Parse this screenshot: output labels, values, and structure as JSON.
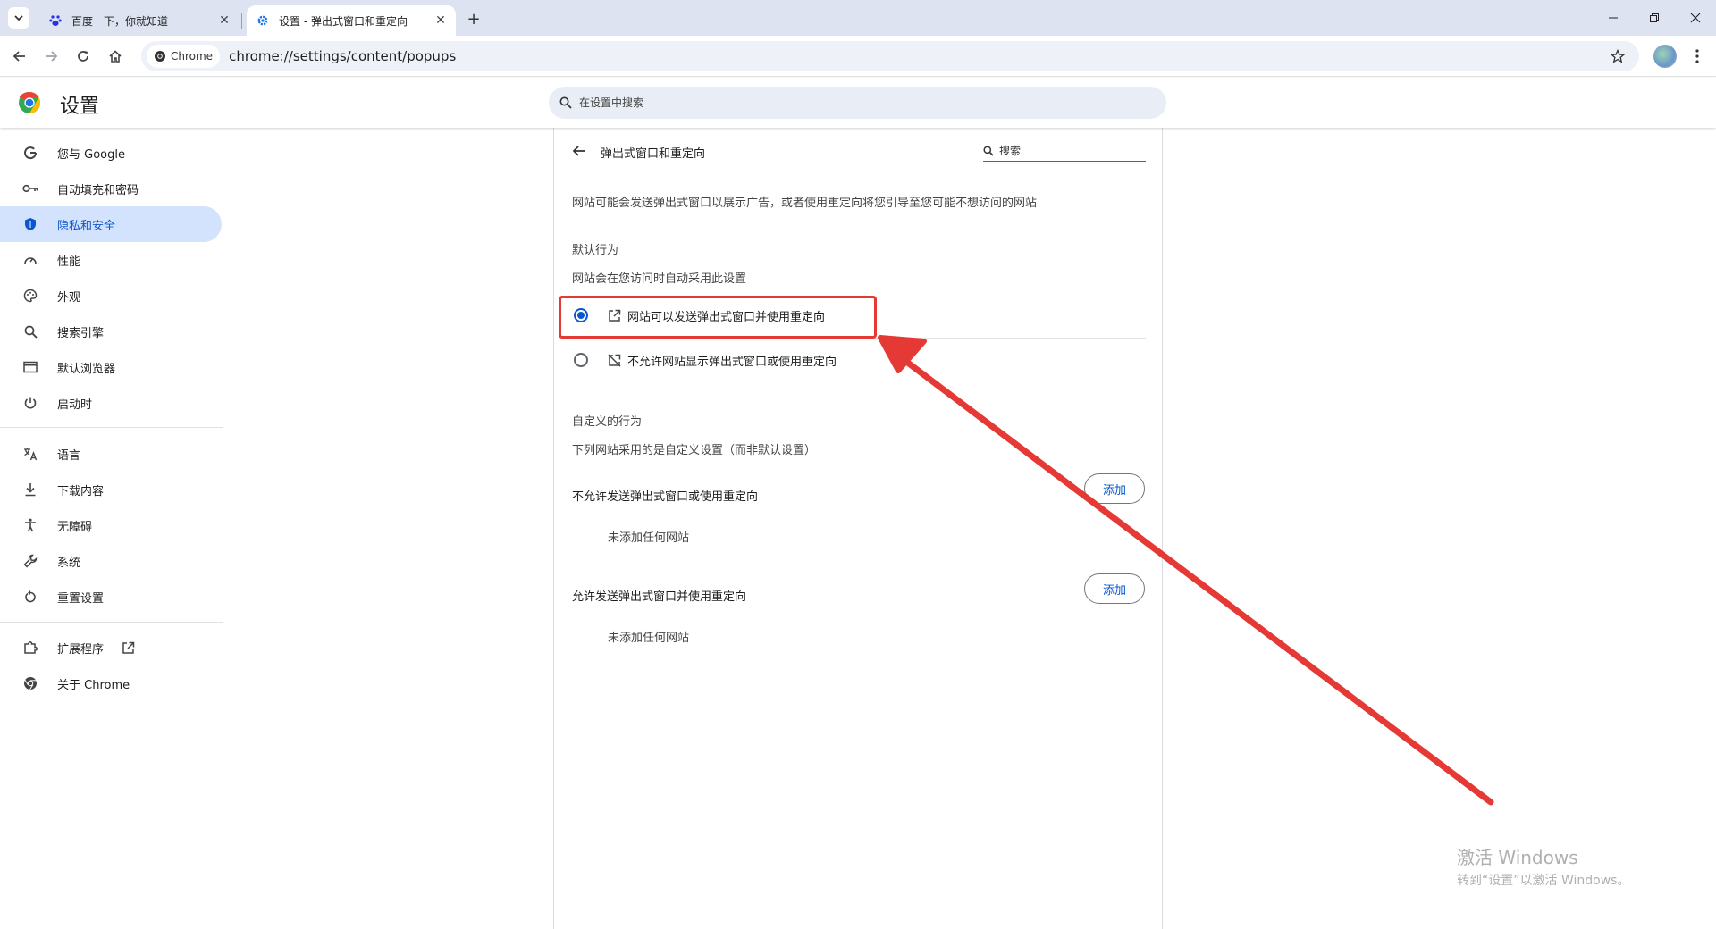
{
  "browser": {
    "tabs": [
      {
        "title": "百度一下，你就知道",
        "active": false,
        "favicon": "baidu-paw-icon"
      },
      {
        "title": "设置 - 弹出式窗口和重定向",
        "active": true,
        "favicon": "settings-gear-icon"
      }
    ],
    "chip_label": "Chrome",
    "url": "chrome://settings/content/popups"
  },
  "header": {
    "title": "设置",
    "search_placeholder": "在设置中搜索"
  },
  "sidebar": {
    "items": [
      {
        "label": "您与 Google",
        "icon": "google-g-icon"
      },
      {
        "label": "自动填充和密码",
        "icon": "key-icon"
      },
      {
        "label": "隐私和安全",
        "icon": "shield-icon",
        "selected": true
      },
      {
        "label": "性能",
        "icon": "speedometer-icon"
      },
      {
        "label": "外观",
        "icon": "palette-icon"
      },
      {
        "label": "搜索引擎",
        "icon": "search-icon"
      },
      {
        "label": "默认浏览器",
        "icon": "browser-window-icon"
      },
      {
        "label": "启动时",
        "icon": "power-icon"
      },
      {
        "label": "语言",
        "icon": "translate-icon"
      },
      {
        "label": "下载内容",
        "icon": "download-icon"
      },
      {
        "label": "无障碍",
        "icon": "accessibility-icon"
      },
      {
        "label": "系统",
        "icon": "wrench-icon"
      },
      {
        "label": "重置设置",
        "icon": "reset-icon"
      },
      {
        "label": "扩展程序",
        "icon": "puzzle-icon"
      },
      {
        "label": "关于 Chrome",
        "icon": "chrome-logo-icon"
      }
    ]
  },
  "page": {
    "title": "弹出式窗口和重定向",
    "search_placeholder": "搜索",
    "description": "网站可能会发送弹出式窗口以展示广告，或者使用重定向将您引导至您可能不想访问的网站",
    "default_section": {
      "title": "默认行为",
      "subtitle": "网站会在您访问时自动采用此设置",
      "options": [
        {
          "label": "网站可以发送弹出式窗口并使用重定向",
          "selected": true,
          "icon": "open-in-new-icon"
        },
        {
          "label": "不允许网站显示弹出式窗口或使用重定向",
          "selected": false,
          "icon": "popup-blocked-icon"
        }
      ]
    },
    "custom_section": {
      "title": "自定义的行为",
      "subtitle": "下列网站采用的是自定义设置（而非默认设置）",
      "lists": [
        {
          "label": "不允许发送弹出式窗口或使用重定向",
          "button": "添加",
          "empty": "未添加任何网站"
        },
        {
          "label": "允许发送弹出式窗口并使用重定向",
          "button": "添加",
          "empty": "未添加任何网站"
        }
      ]
    }
  },
  "watermark": {
    "line1": "激活 Windows",
    "line2": "转到“设置”以激活 Windows。"
  },
  "colors": {
    "accent": "#0b57d0",
    "selected_bg": "#d3e3fd",
    "annotation": "#e53935"
  }
}
